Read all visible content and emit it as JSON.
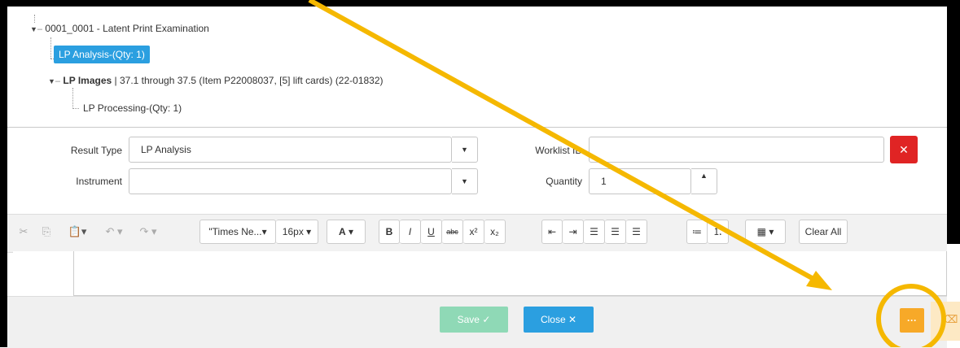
{
  "tree": {
    "root_label": "0001_0001 - Latent Print Examination",
    "selected_label": "LP Analysis-(Qty: 1)",
    "images_bold": "LP Images",
    "images_detail": " | 37.1 through 37.5 (Item P22008037, [5] lift cards) (22-01832)",
    "processing_label": "LP Processing-(Qty: 1)"
  },
  "form": {
    "result_type_label": "Result Type",
    "result_type_value": "LP Analysis",
    "worklist_label": "Worklist ID",
    "worklist_value": "",
    "instrument_label": "Instrument",
    "instrument_value": "",
    "quantity_label": "Quantity",
    "quantity_value": "1"
  },
  "toolbar": {
    "font_name": "\"Times Ne...",
    "font_size": "16px",
    "clear_all": "Clear All"
  },
  "footer": {
    "save_label": "Save",
    "close_label": "Close",
    "more_label": "···"
  },
  "colors": {
    "selected_bg": "#2b9fe0",
    "save_bg": "#8fd9b6",
    "close_bg": "#2b9fe0",
    "delete_bg": "#e02424",
    "more_bg": "#f7a928",
    "annotation": "#f5b800"
  },
  "icons": [
    "scissors-icon",
    "copy-icon",
    "paste-icon",
    "undo-icon",
    "redo-icon",
    "bold-icon",
    "italic-icon",
    "underline-icon",
    "strikethrough-icon",
    "superscript-icon",
    "subscript-icon",
    "outdent-icon",
    "indent-icon",
    "align-left-icon",
    "align-center-icon",
    "align-right-icon",
    "bullet-list-icon",
    "numbered-list-icon",
    "more-icon",
    "check-icon",
    "close-icon"
  ]
}
